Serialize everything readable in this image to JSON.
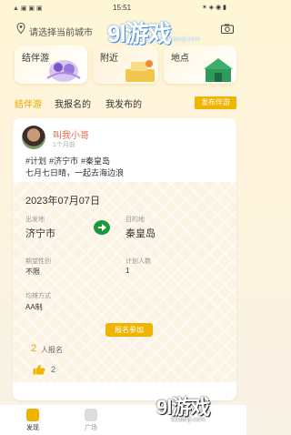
{
  "status_bar": {
    "left": "▲ ▣ ▣ ▣",
    "time": "15:51",
    "right": "✶ ◈ ◉ ▮"
  },
  "location": {
    "placeholder": "请选择当前城市"
  },
  "watermark": {
    "top_main": "9l游戏",
    "top_sub": "91danji.com",
    "bottom_main": "9l游戏",
    "bottom_sub": "91danji.com"
  },
  "categories": [
    {
      "label": "结伴游"
    },
    {
      "label": "附近"
    },
    {
      "label": "地点"
    }
  ],
  "tabs": [
    {
      "label": "结伴游",
      "active": true
    },
    {
      "label": "我报名的",
      "active": false
    },
    {
      "label": "我发布的",
      "active": false
    }
  ],
  "publish_button": "发布伴游",
  "post": {
    "nickname": "叫我小哥",
    "time_ago": "1个月前",
    "tags": [
      "#计划",
      "#济宁市",
      "#秦皇岛"
    ],
    "description": "七月七日晴，一起去海边浪",
    "trip_date": "2023年07月07日",
    "origin_label": "出发地",
    "origin": "济宁市",
    "destination_label": "目的地",
    "destination": "秦皇岛",
    "gender_label": "期望性别",
    "gender": "不限",
    "people_label": "计划人数",
    "people": "1",
    "payment_label": "均摊方式",
    "payment": "AA制",
    "join_button": "报名参加",
    "signup_count": "2",
    "signup_label": "人报名",
    "likes": "2"
  },
  "nav": [
    {
      "label": "发现"
    },
    {
      "label": "广场"
    }
  ],
  "colors": {
    "accent": "#f0b400",
    "nickname": "#e26a50",
    "go_arrow": "#1a9a3a"
  }
}
